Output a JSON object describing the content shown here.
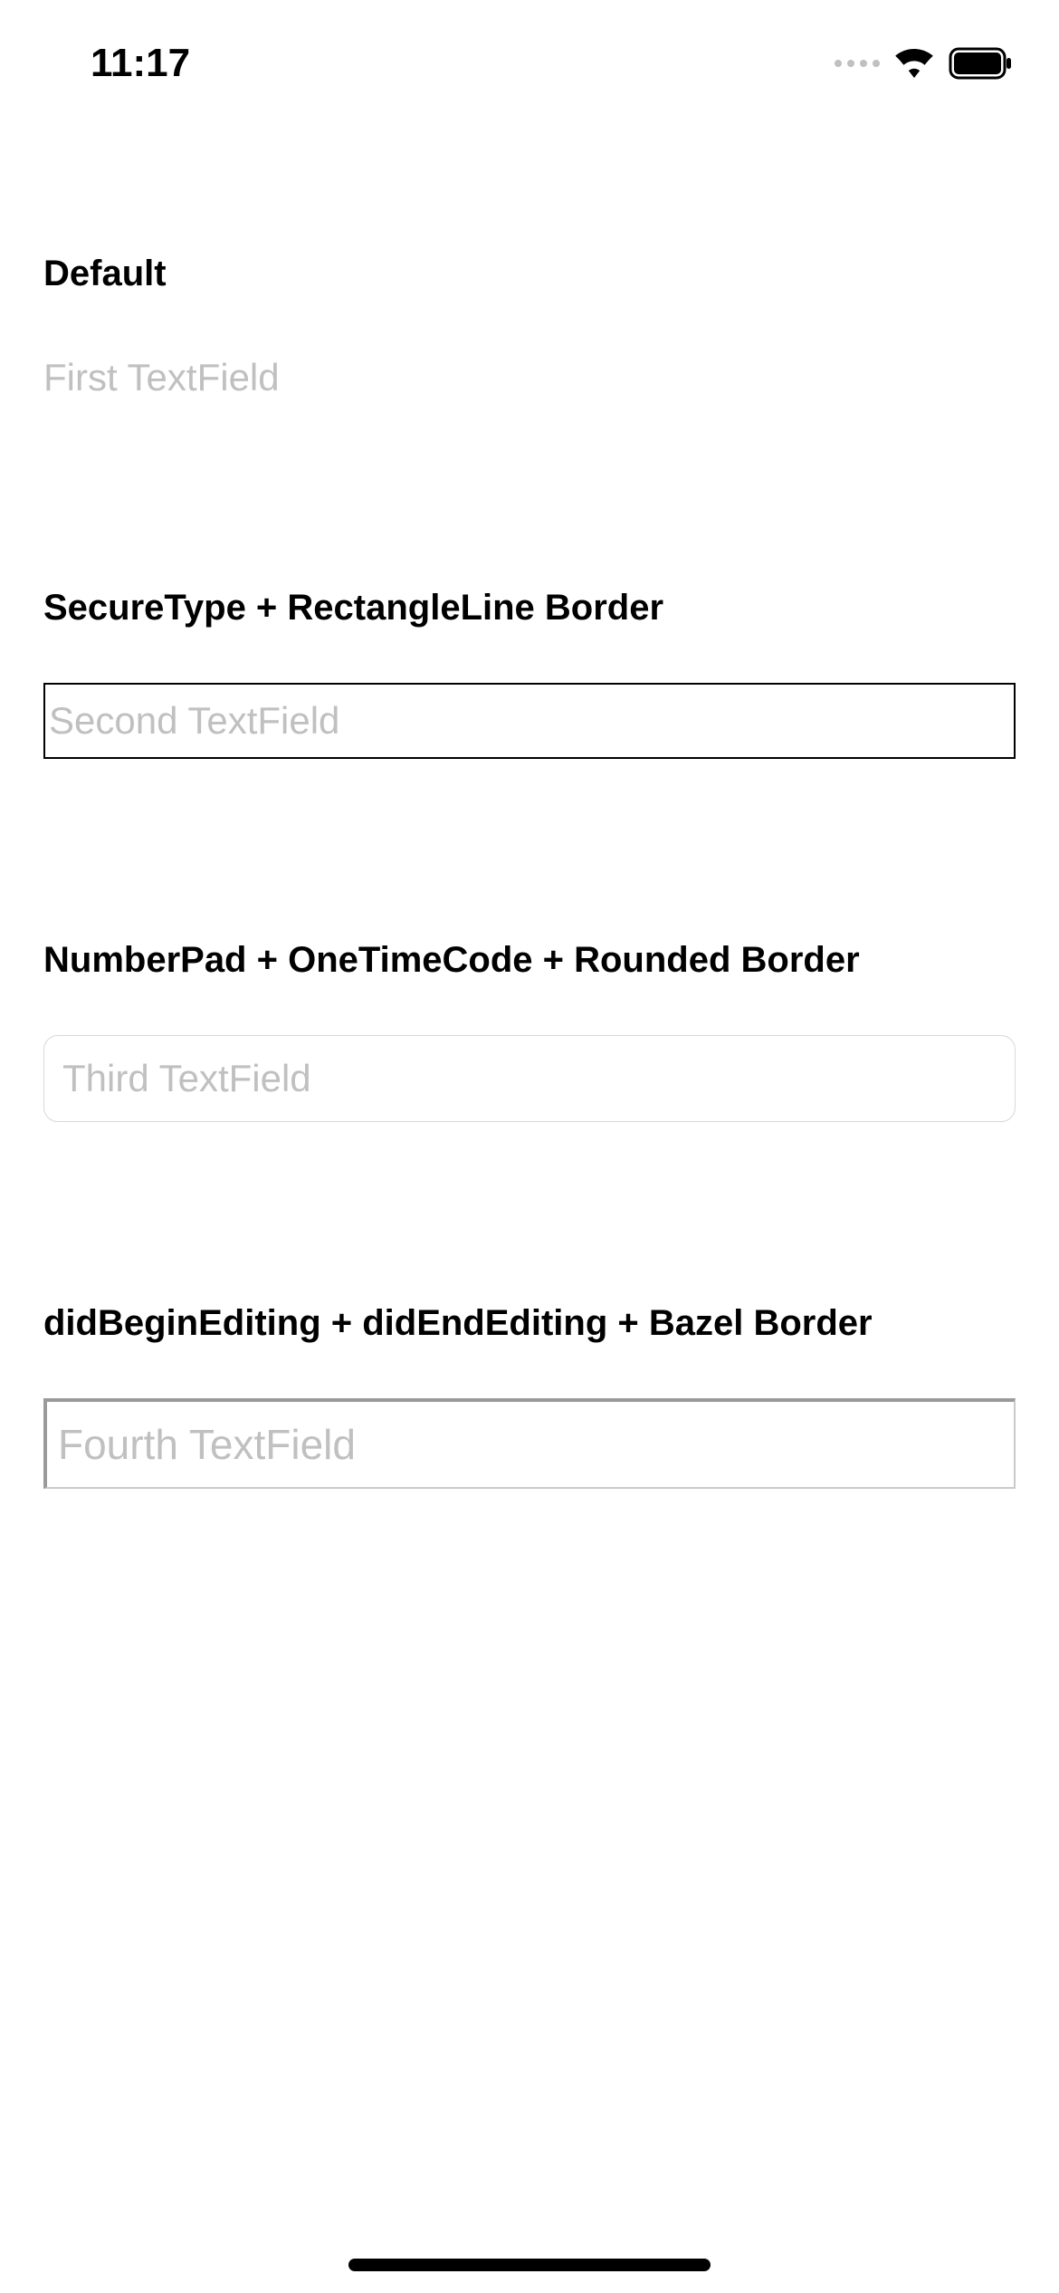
{
  "statusBar": {
    "time": "11:17"
  },
  "sections": {
    "section1": {
      "label": "Default",
      "placeholder": "First TextField"
    },
    "section2": {
      "label": "SecureType + RectangleLine Border",
      "placeholder": "Second TextField"
    },
    "section3": {
      "label": "NumberPad + OneTimeCode + Rounded Border",
      "placeholder": "Third TextField"
    },
    "section4": {
      "label": "didBeginEditing + didEndEditing + Bazel Border",
      "placeholder": "Fourth TextField"
    }
  }
}
